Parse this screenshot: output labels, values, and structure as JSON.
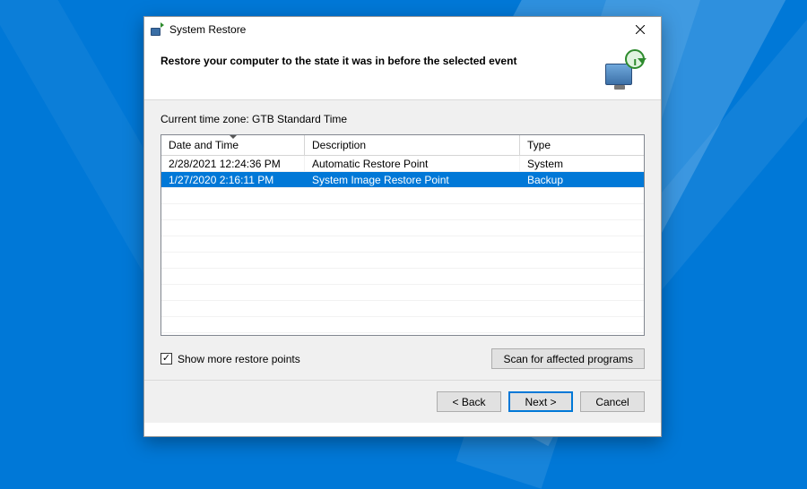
{
  "window": {
    "title": "System Restore"
  },
  "header": {
    "heading": "Restore your computer to the state it was in before the selected event"
  },
  "timezone_label": "Current time zone: GTB Standard Time",
  "columns": {
    "date": "Date and Time",
    "description": "Description",
    "type": "Type"
  },
  "rows": [
    {
      "date": "2/28/2021 12:24:36 PM",
      "description": "Automatic Restore Point",
      "type": "System",
      "selected": false
    },
    {
      "date": "1/27/2020 2:16:11 PM",
      "description": "System Image Restore Point",
      "type": "Backup",
      "selected": true
    }
  ],
  "show_more": {
    "label": "Show more restore points",
    "checked": true
  },
  "buttons": {
    "scan": "Scan for affected programs",
    "back": "< Back",
    "next": "Next >",
    "cancel": "Cancel"
  }
}
